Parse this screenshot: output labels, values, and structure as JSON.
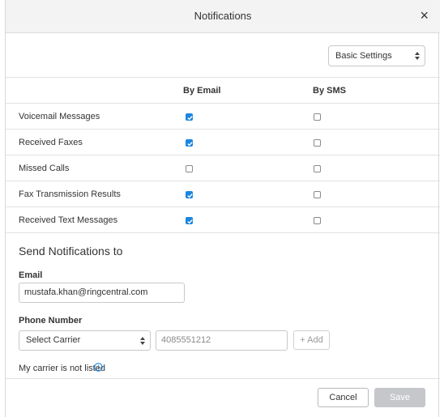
{
  "dialog": {
    "title": "Notifications",
    "close_label": "×"
  },
  "settings_select": {
    "selected": "Basic Settings"
  },
  "columns": {
    "email": "By Email",
    "sms": "By SMS"
  },
  "rows": [
    {
      "label": "Voicemail Messages",
      "email": true,
      "sms": false
    },
    {
      "label": "Received Faxes",
      "email": true,
      "sms": false
    },
    {
      "label": "Missed Calls",
      "email": false,
      "sms": false
    },
    {
      "label": "Fax Transmission Results",
      "email": true,
      "sms": false
    },
    {
      "label": "Received Text Messages",
      "email": true,
      "sms": false
    }
  ],
  "send_to": {
    "title": "Send Notifications to",
    "email_label": "Email",
    "email_value": "mustafa.khan@ringcentral.com",
    "phone_label": "Phone Number",
    "carrier_selected": "Select Carrier",
    "phone_placeholder": "4085551212",
    "add_label": "+ Add",
    "carrier_note": "My carrier is not listed"
  },
  "footer": {
    "cancel_label": "Cancel",
    "save_label": "Save"
  },
  "colors": {
    "accent": "#1a86e0",
    "save_disabled": "#c5c7ca"
  }
}
